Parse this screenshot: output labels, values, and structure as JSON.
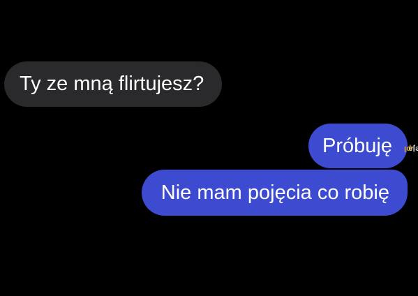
{
  "messages": [
    {
      "direction": "received",
      "text": "Ty ze mną flirtujesz?"
    },
    {
      "direction": "sent",
      "text": "Próbuję"
    },
    {
      "direction": "sent",
      "text": "Nie mam pojęcia co robię"
    }
  ],
  "watermark": {
    "text": "jeja",
    "accent_text": ".pl"
  },
  "colors": {
    "background": "#000000",
    "received_bubble": "#2a2a2c",
    "sent_bubble": "#3d4bd0",
    "text": "#ffffff"
  }
}
